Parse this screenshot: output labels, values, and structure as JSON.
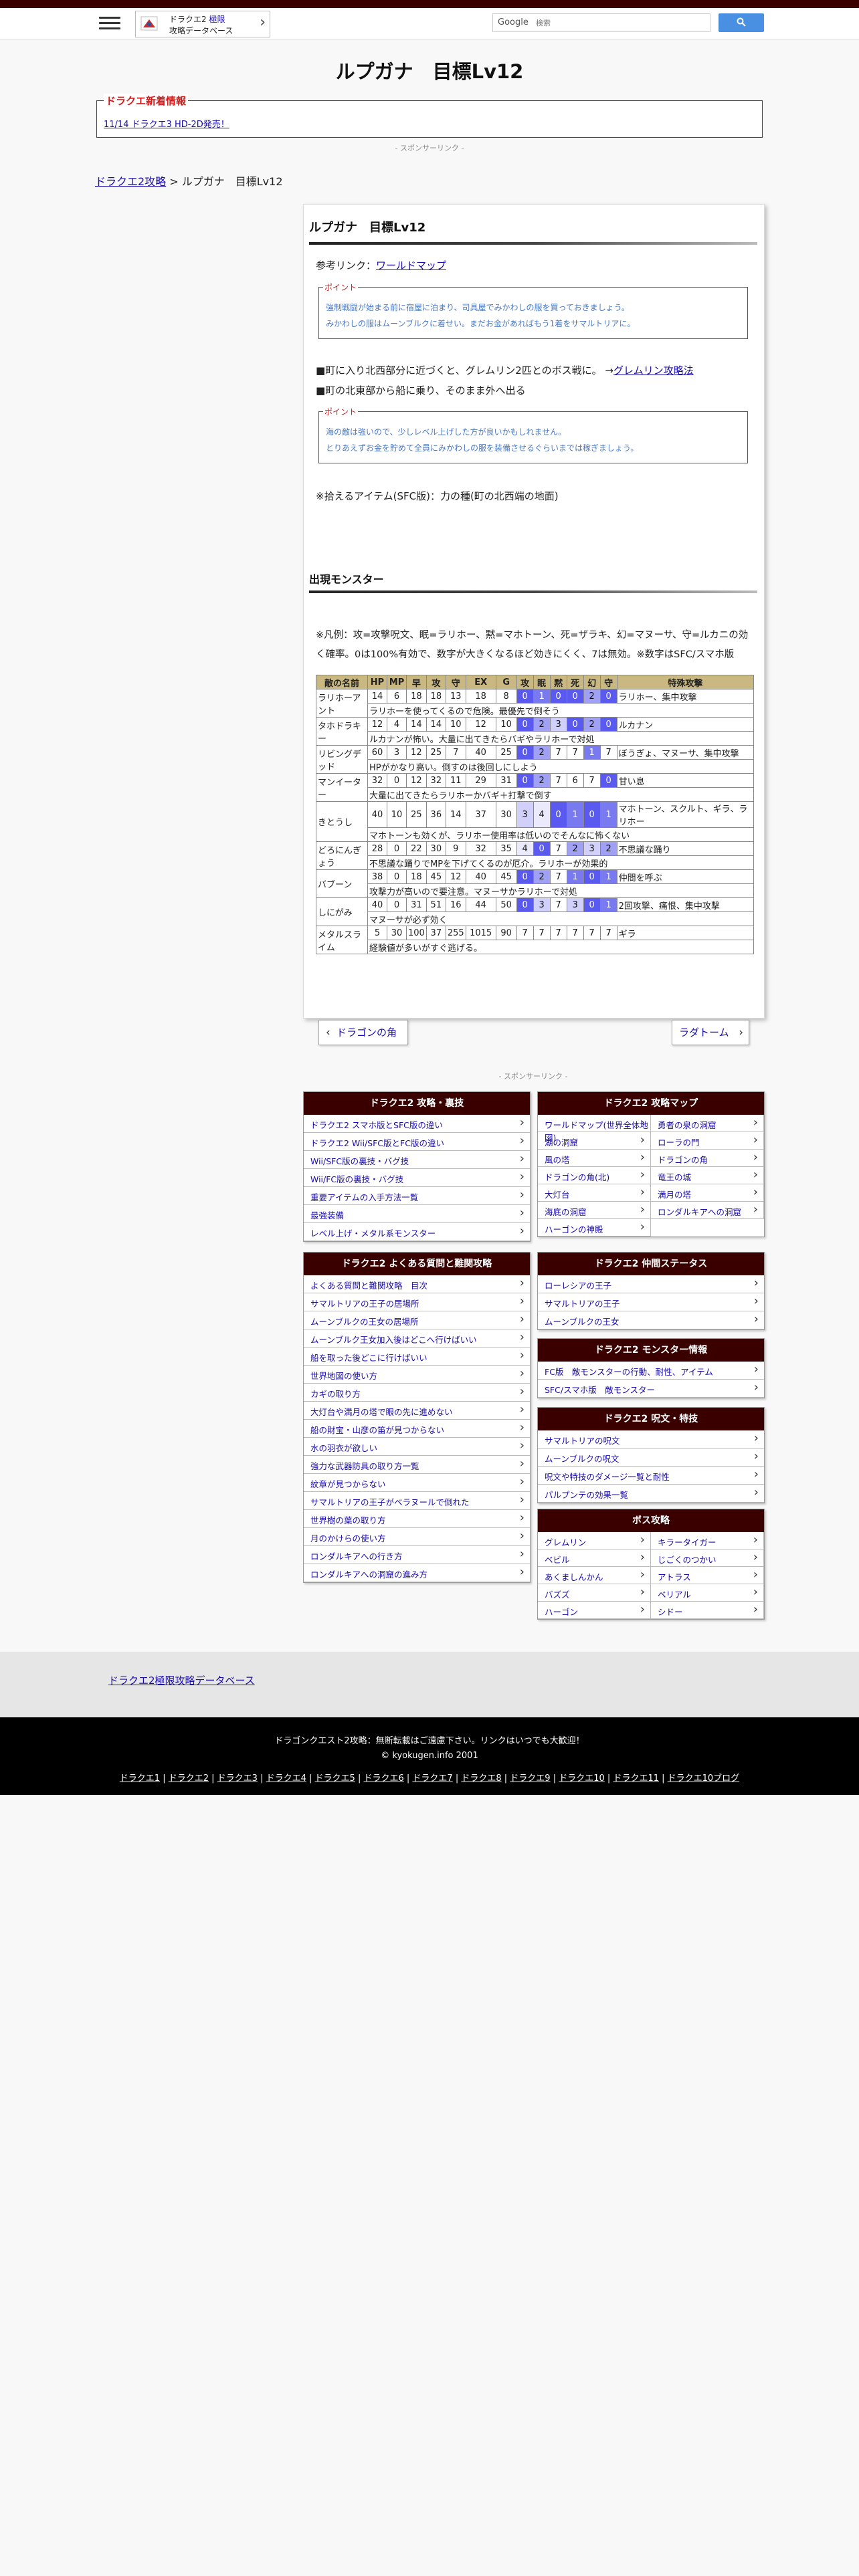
{
  "header": {
    "site_line1_a": "ドラクエ2",
    "site_line1_b": "極限",
    "site_line2": "攻略データベース",
    "search_brand": "Google",
    "search_placeholder": "検索"
  },
  "page_title": "ルプガナ　目標Lv12",
  "news": {
    "legend": "ドラクエ新着情報",
    "link": "11/14 ドラクエ3 HD-2D発売！"
  },
  "sponsor": "- スポンサーリンク -",
  "breadcrumb": {
    "home": "ドラクエ2攻略",
    "sep": " > ",
    "current": "ルプガナ　目標Lv12"
  },
  "article": {
    "title": "ルプガナ　目標Lv12",
    "ref_label": "参考リンク：",
    "ref_link": "ワールドマップ",
    "point_label": "ポイント",
    "point1": [
      "強制戦闘が始まる前に宿屋に泊まり、司具屋でみかわしの服を買っておきましょう。",
      "みかわしの服はムーンブルクに着せい。まだお金があればもう1着をサマルトリアに。"
    ],
    "step1": "■町に入り北西部分に近づくと、グレムリン2匹とのボス戦に。 →",
    "step1_link": "グレムリン攻略法",
    "step2": "■町の北東部から船に乗り、そのまま外へ出る",
    "point2": [
      "海の敵は強いので、少しレベル上げした方が良いかもしれません。",
      "とりあえずお金を貯めて全員にみかわしの服を装備させるぐらいまでは稼ぎましょう。"
    ],
    "item": "※拾えるアイテム(SFC版)：力の種(町の北西端の地面)",
    "monster_title": "出現モンスター",
    "legend": "※凡例：攻=攻撃呪文、眠=ラリホー、黙=マホトーン、死=ザラキ、幻=マヌーサ、守=ルカニの効く確率。0は100%有効で、数字が大きくなるほど効きにくく、7は無効。※数字はSFC/スマホ版",
    "prev_btn": "ドラゴンの角",
    "next_btn": "ラダトーム"
  },
  "table": {
    "headers": [
      "敵の名前",
      "HP",
      "MP",
      "早",
      "攻",
      "守",
      "EX",
      "G",
      "攻",
      "眠",
      "黙",
      "死",
      "幻",
      "守",
      "特殊攻撃"
    ],
    "rows": [
      {
        "name": "ラリホーアント",
        "hp": "14",
        "mp": "6",
        "spd": "18",
        "atk": "18",
        "def": "13",
        "ex": "18",
        "g": "8",
        "r": [
          "0",
          "1",
          "0",
          "0",
          "2",
          "0"
        ],
        "special": "ラリホー、集中攻撃",
        "note": "ラリホーを使ってくるので危険。最優先で倒そう"
      },
      {
        "name": "タホドラキー",
        "hp": "12",
        "mp": "4",
        "spd": "14",
        "atk": "14",
        "def": "10",
        "ex": "12",
        "g": "10",
        "r": [
          "0",
          "2",
          "3",
          "0",
          "2",
          "0"
        ],
        "special": "ルカナン",
        "note": "ルカナンが怖い。大量に出てきたらバギやラリホーで対処"
      },
      {
        "name": "リビングデッド",
        "hp": "60",
        "mp": "3",
        "spd": "12",
        "atk": "25",
        "def": "7",
        "ex": "40",
        "g": "25",
        "r": [
          "0",
          "2",
          "7",
          "7",
          "1",
          "7"
        ],
        "special": "ぼうぎょ、マヌーサ、集中攻撃",
        "note": "HPがかなり高い。倒すのは後回しにしよう"
      },
      {
        "name": "マンイーター",
        "hp": "32",
        "mp": "0",
        "spd": "12",
        "atk": "32",
        "def": "11",
        "ex": "29",
        "g": "31",
        "r": [
          "0",
          "2",
          "7",
          "6",
          "7",
          "0"
        ],
        "special": "甘い息",
        "note": "大量に出てきたらラリホーかバギ＋打撃で倒す"
      },
      {
        "name": "きとうし",
        "hp": "40",
        "mp": "10",
        "spd": "25",
        "atk": "36",
        "def": "14",
        "ex": "37",
        "g": "30",
        "r": [
          "3",
          "4",
          "0",
          "1",
          "0",
          "1"
        ],
        "special": "マホトーン、スクルト、ギラ、ラリホー",
        "note": "マホトーンも効くが、ラリホー使用率は低いのでそんなに怖くない"
      },
      {
        "name": "どろにんぎょう",
        "hp": "28",
        "mp": "0",
        "spd": "22",
        "atk": "30",
        "def": "9",
        "ex": "32",
        "g": "35",
        "r": [
          "4",
          "0",
          "7",
          "2",
          "3",
          "2"
        ],
        "special": "不思議な踊り",
        "note": "不思議な踊りでMPを下げてくるのが厄介。ラリホーが効果的"
      },
      {
        "name": "バブーン",
        "hp": "38",
        "mp": "0",
        "spd": "18",
        "atk": "45",
        "def": "12",
        "ex": "40",
        "g": "45",
        "r": [
          "0",
          "2",
          "7",
          "1",
          "0",
          "1"
        ],
        "special": "仲間を呼ぶ",
        "note": "攻撃力が高いので要注意。マヌーサかラリホーで対処"
      },
      {
        "name": "しにがみ",
        "hp": "40",
        "mp": "0",
        "spd": "31",
        "atk": "51",
        "def": "16",
        "ex": "44",
        "g": "50",
        "r": [
          "0",
          "3",
          "7",
          "3",
          "0",
          "1"
        ],
        "special": "2回攻撃、痛恨、集中攻撃",
        "note": "マヌーサが必ず効く"
      },
      {
        "name": "メタルスライム",
        "hp": "5",
        "mp": "30",
        "spd": "100",
        "atk": "37",
        "def": "255",
        "ex": "1015",
        "g": "90",
        "r": [
          "7",
          "7",
          "7",
          "7",
          "7",
          "7"
        ],
        "special": "ギラ",
        "note": "経験値が多いがすぐ逃げる。"
      }
    ]
  },
  "sidebar": {
    "box1": {
      "title": "ドラクエ2 攻略・裏技",
      "items": [
        "ドラクエ2 スマホ版とSFC版の違い",
        "ドラクエ2 Wii/SFC版とFC版の違い",
        "Wii/SFC版の裏技・バグ技",
        "Wii/FC版の裏技・バグ技",
        "重要アイテムの入手方法一覧",
        "最強装備",
        "レベル上げ・メタル系モンスター"
      ]
    },
    "box2": {
      "title": "ドラクエ2 よくある質問と難関攻略",
      "items": [
        "よくある質問と難関攻略　目次",
        "サマルトリアの王子の居場所",
        "ムーンブルクの王女の居場所",
        "ムーンブルク王女加入後はどこへ行けばいい",
        "船を取った後どこに行けばいい",
        "世界地図の使い方",
        "カギの取り方",
        "大灯台や満月の塔で眼の先に進めない",
        "船の財宝・山彦の笛が見つからない",
        "水の羽衣が欲しい",
        "強力な武器防具の取り方一覧",
        "紋章が見つからない",
        "サマルトリアの王子がベラヌールで倒れた",
        "世界樹の葉の取り方",
        "月のかけらの使い方",
        "ロンダルキアへの行き方",
        "ロンダルキアへの洞窟の進み方"
      ]
    },
    "box3": {
      "title": "ドラクエ2 攻略マップ",
      "items": [
        "ワールドマップ(世界全体地図)",
        "勇者の泉の洞窟",
        "湖の洞窟",
        "ローラの門",
        "風の塔",
        "ドラゴンの角",
        "ドラゴンの角(北)",
        "竜王の城",
        "大灯台",
        "満月の塔",
        "海底の洞窟",
        "ロンダルキアへの洞窟",
        "ハーゴンの神殿"
      ]
    },
    "box4": {
      "title": "ドラクエ2 仲間ステータス",
      "items": [
        "ローレシアの王子",
        "サマルトリアの王子",
        "ムーンブルクの王女"
      ]
    },
    "box5": {
      "title": "ドラクエ2 モンスター情報",
      "items": [
        "FC版　敵モンスターの行動、耐性、アイテム",
        "SFC/スマホ版　敵モンスター"
      ]
    },
    "box6": {
      "title": "ドラクエ2 呪文・特技",
      "items": [
        "サマルトリアの呪文",
        "ムーンブルクの呪文",
        "呪文や特技のダメージ一覧と耐性",
        "パルプンテの効果一覧"
      ]
    },
    "box7": {
      "title": "ボス攻略",
      "items": [
        "グレムリン",
        "キラータイガー",
        "ベビル",
        "じごくのつかい",
        "あくましんかん",
        "アトラス",
        "バズズ",
        "ベリアル",
        "ハーゴン",
        "シドー"
      ]
    }
  },
  "footer": {
    "db_link": "ドラクエ2極限攻略データベース",
    "notice": "ドラゴンクエスト2攻略：無断転載はご遠慮下さい。リンクはいつでも大歓迎！",
    "copyright": "© kyokugen.info 2001",
    "links": [
      "ドラクエ1",
      "ドラクエ2",
      "ドラクエ3",
      "ドラクエ4",
      "ドラクエ5",
      "ドラクエ6",
      "ドラクエ7",
      "ドラクエ8",
      "ドラクエ9",
      "ドラクエ10",
      "ドラクエ11",
      "ドラクエ10ブログ"
    ]
  }
}
